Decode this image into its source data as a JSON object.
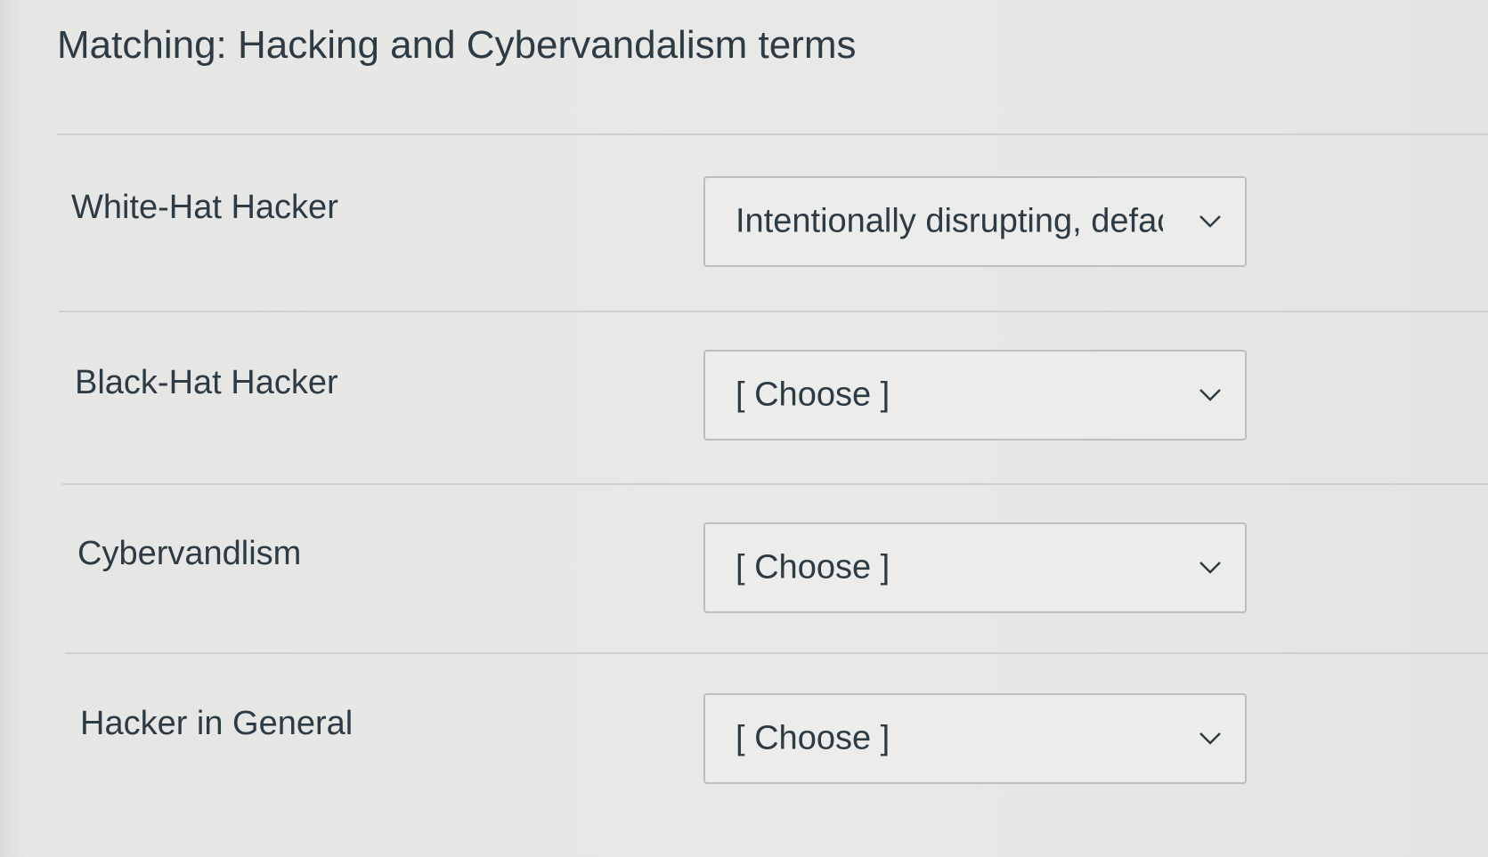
{
  "quiz": {
    "title": "Matching: Hacking and Cybervandalism terms",
    "rows": [
      {
        "term": "White-Hat Hacker",
        "selected": "Intentionally disrupting, defac"
      },
      {
        "term": "Black-Hat Hacker",
        "selected": "[ Choose ]"
      },
      {
        "term": "Cybervandlism",
        "selected": "[ Choose ]"
      },
      {
        "term": "Hacker in General",
        "selected": "[ Choose ]"
      }
    ]
  },
  "icons": {
    "dropdown": "chevron-down-icon"
  },
  "colors": {
    "text": "#2d3b45",
    "border": "#bdbdbb",
    "background": "#e8e8e6"
  }
}
